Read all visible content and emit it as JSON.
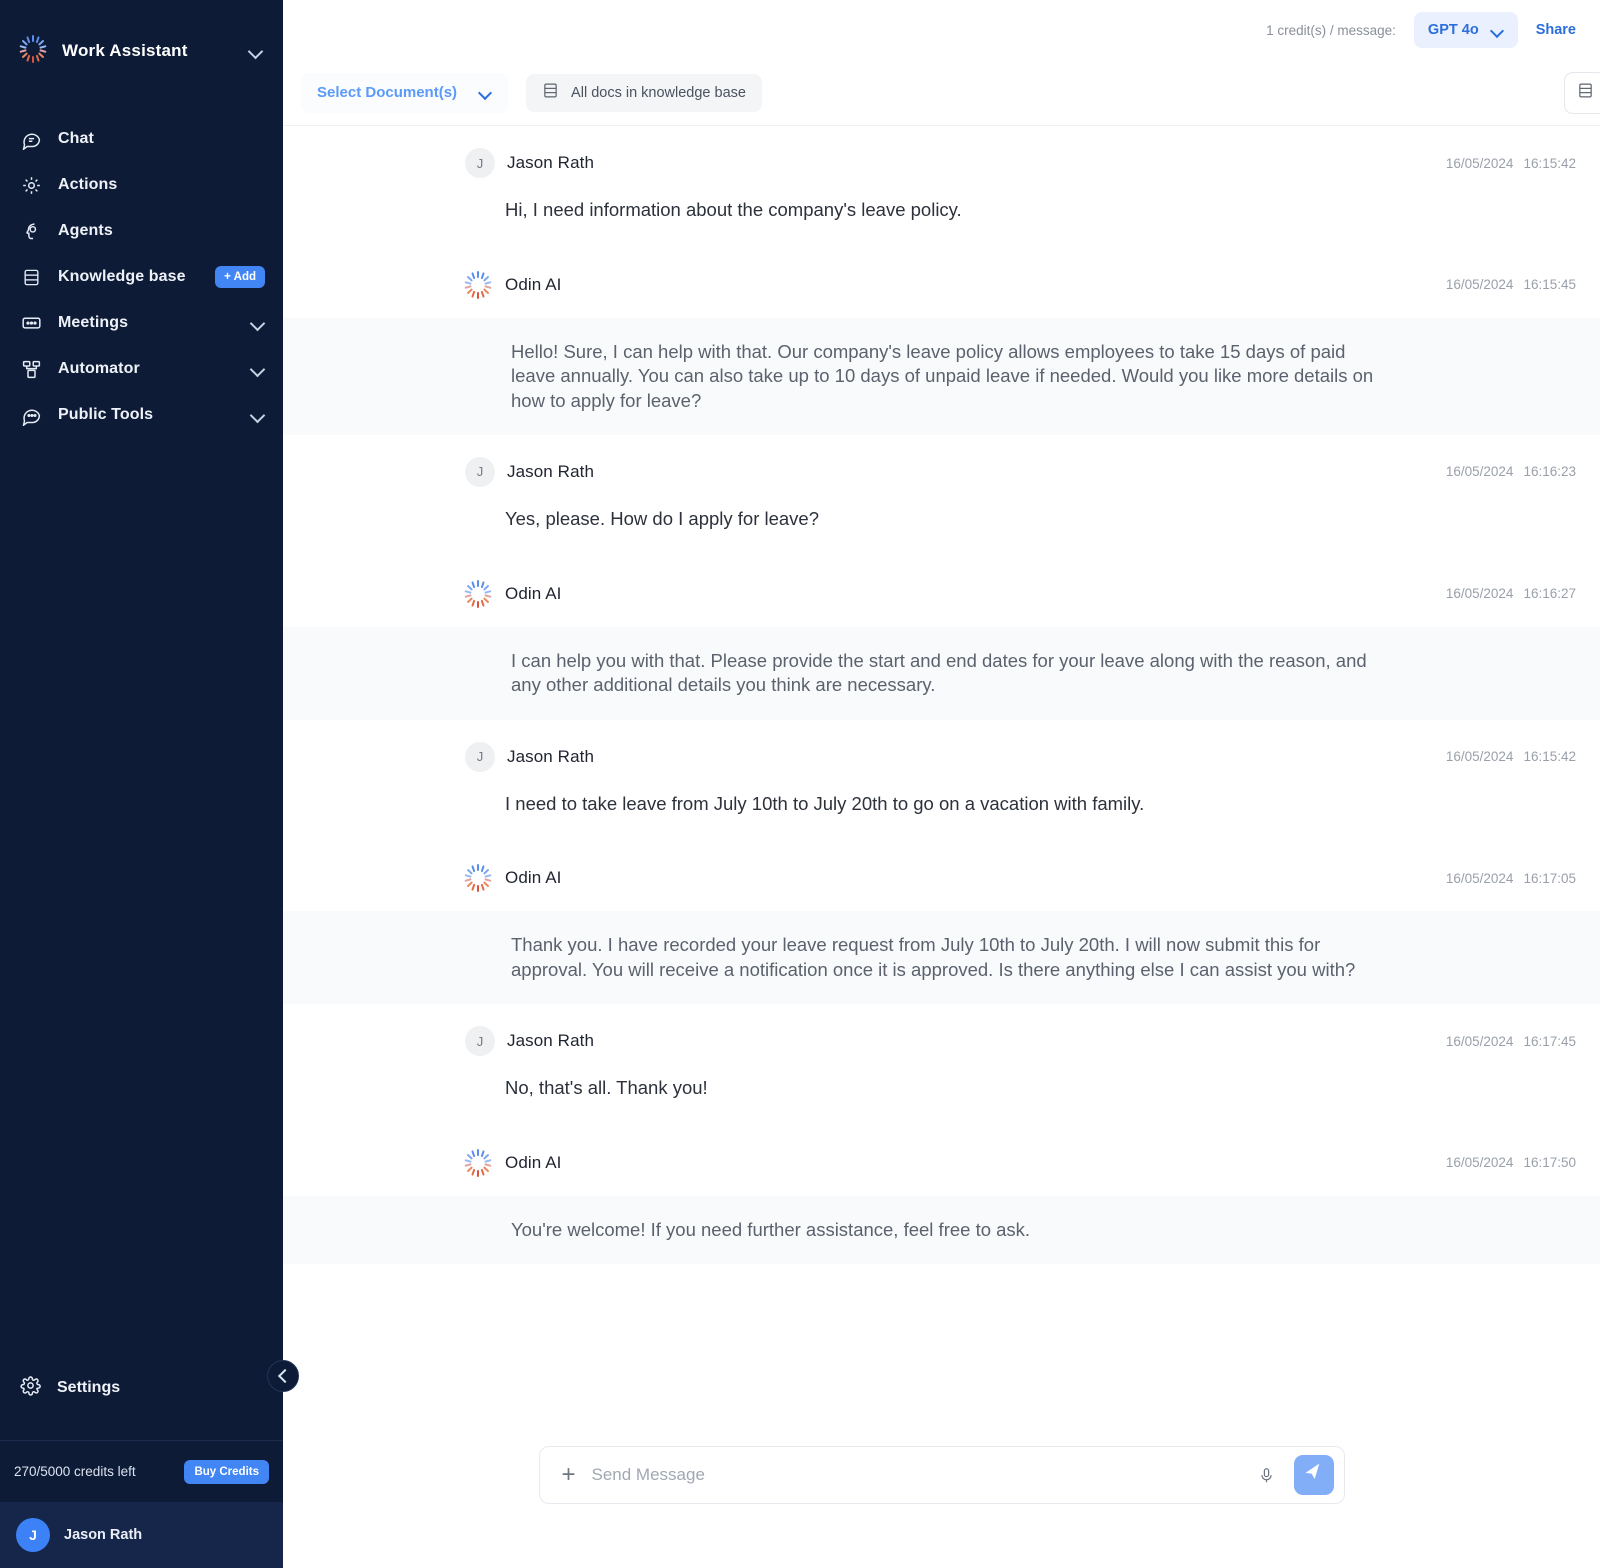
{
  "sidebar": {
    "brand": {
      "title": "Work Assistant",
      "logo_icon": "odin-burst-logo",
      "chevron_icon": "chevron-down-icon"
    },
    "items": [
      {
        "label": "Chat",
        "icon": "chat-bubble-icon",
        "badge": null,
        "chevron": false
      },
      {
        "label": "Actions",
        "icon": "target-gear-icon",
        "badge": null,
        "chevron": false
      },
      {
        "label": "Agents",
        "icon": "agent-head-icon",
        "badge": null,
        "chevron": false
      },
      {
        "label": "Knowledge base",
        "icon": "database-icon",
        "badge": "+ Add",
        "chevron": false
      },
      {
        "label": "Meetings",
        "icon": "meeting-screen-icon",
        "badge": null,
        "chevron": true
      },
      {
        "label": "Automator",
        "icon": "workflow-nodes-icon",
        "badge": null,
        "chevron": true
      },
      {
        "label": "Public Tools",
        "icon": "public-chat-icon",
        "badge": null,
        "chevron": true
      }
    ],
    "settings": {
      "label": "Settings",
      "icon": "gear-icon"
    },
    "credits": {
      "text": "270/5000 credits left",
      "buy_label": "Buy Credits"
    },
    "user": {
      "initial": "J",
      "name": "Jason Rath"
    },
    "collapse_icon": "chevron-left-icon"
  },
  "topbar": {
    "credit_note": "1 credit(s) / message:",
    "model": "GPT 4o",
    "model_chevron_icon": "chevron-down-icon",
    "share_label": "Share"
  },
  "docbar": {
    "select_documents_label": "Select Document(s)",
    "select_chevron_icon": "chevron-down-icon",
    "all_docs_label": "All docs in knowledge base",
    "all_docs_icon": "database-icon",
    "kb_panel_icon": "database-panel-icon"
  },
  "conversation": [
    {
      "role": "user",
      "sender": "Jason Rath",
      "avatar_initial": "J",
      "date": "16/05/2024",
      "time": "16:15:42",
      "text": "Hi, I need information about the company's leave policy."
    },
    {
      "role": "ai",
      "sender": "Odin AI",
      "avatar_icon": "odin-burst-logo",
      "date": "16/05/2024",
      "time": "16:15:45",
      "text": "Hello! Sure, I can help with that. Our company's leave policy allows employees to take 15 days of paid leave annually. You can also take up to 10 days of unpaid leave if needed. Would you like more details on how to apply for leave?"
    },
    {
      "role": "user",
      "sender": "Jason Rath",
      "avatar_initial": "J",
      "date": "16/05/2024",
      "time": "16:16:23",
      "text": "Yes, please. How do I apply for leave?"
    },
    {
      "role": "ai",
      "sender": "Odin AI",
      "avatar_icon": "odin-burst-logo",
      "date": "16/05/2024",
      "time": "16:16:27",
      "text": "I can help you with that. Please provide the start and end dates for your leave along with the reason, and any other additional details you think are necessary."
    },
    {
      "role": "user",
      "sender": "Jason Rath",
      "avatar_initial": "J",
      "date": "16/05/2024",
      "time": "16:15:42",
      "text": "I need to take leave from July 10th to July 20th to go on a vacation with family."
    },
    {
      "role": "ai",
      "sender": "Odin AI",
      "avatar_icon": "odin-burst-logo",
      "date": "16/05/2024",
      "time": "16:17:05",
      "text": "Thank you. I have recorded your leave request from July 10th to July 20th. I will now submit this for approval. You will receive a notification once it is approved. Is there anything else I can assist you with?"
    },
    {
      "role": "user",
      "sender": "Jason Rath",
      "avatar_initial": "J",
      "date": "16/05/2024",
      "time": "16:17:45",
      "text": "No, that's all. Thank you!"
    },
    {
      "role": "ai",
      "sender": "Odin AI",
      "avatar_icon": "odin-burst-logo",
      "date": "16/05/2024",
      "time": "16:17:50",
      "text": "You're welcome! If you need further assistance, feel free to ask."
    }
  ],
  "composer": {
    "placeholder": "Send Message",
    "value": "",
    "plus_icon": "plus-icon",
    "mic_icon": "microphone-icon",
    "send_icon": "send-paper-plane-icon"
  },
  "colors": {
    "sidebar_bg": "#0d1b36",
    "accent_blue": "#4286f5",
    "link_blue": "#2b6fdb",
    "ai_bubble_bg": "#f9fafb"
  }
}
